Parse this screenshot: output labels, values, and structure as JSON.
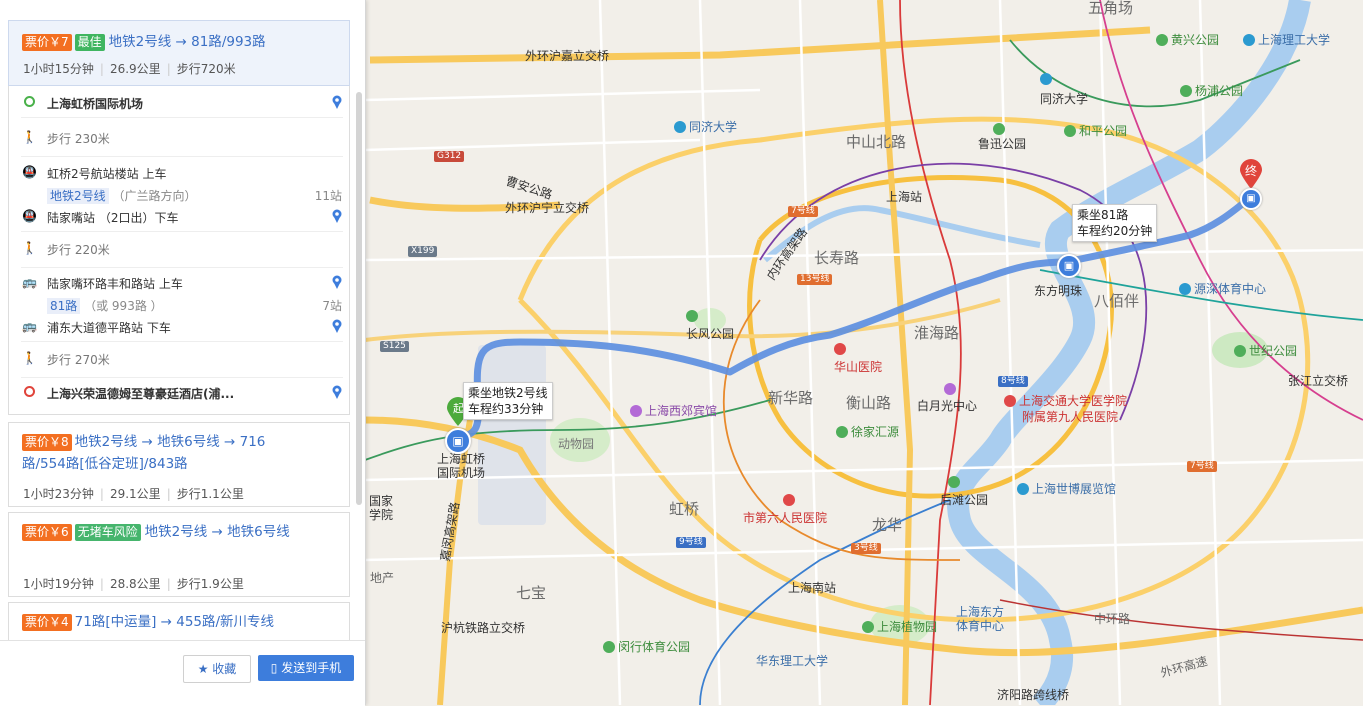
{
  "routes": [
    {
      "fare": "票价￥7",
      "tag": "最佳",
      "title": "地铁2号线 → 81路/993路",
      "duration": "1小时15分钟",
      "distance": "26.9公里",
      "walk": "步行720米"
    },
    {
      "fare": "票价￥8",
      "tag": "",
      "title_line1": "地铁2号线 → 地铁6号线 → 716",
      "title_line2": "路/554路[低谷定班]/843路",
      "duration": "1小时23分钟",
      "distance": "29.1公里",
      "walk": "步行1.1公里"
    },
    {
      "fare": "票价￥6",
      "tag": "无堵车风险",
      "title": "地铁2号线 → 地铁6号线",
      "duration": "1小时19分钟",
      "distance": "28.8公里",
      "walk": "步行1.9公里"
    },
    {
      "fare": "票价￥4",
      "tag": "",
      "title": "71路[中运量] → 455路/新川专线"
    }
  ],
  "steps": {
    "origin": "上海虹桥国际机场",
    "walk1": "步行  230米",
    "board1": "虹桥2号航站楼站  上车",
    "line1": "地铁2号线",
    "line1_dir": "（广兰路方向）",
    "line1_stops": "11站",
    "alight1": "陆家嘴站  （2口出）下车",
    "walk2": "步行  220米",
    "board2": "陆家嘴环路丰和路站  上车",
    "line2": "81路",
    "line2_alt": "（或 993路 ）",
    "line2_stops": "7站",
    "alight2": "浦东大道德平路站  下车",
    "walk3": "步行  270米",
    "destination": "上海兴荣温德姆至尊豪廷酒店(浦..."
  },
  "buttons": {
    "favorite": "收藏",
    "send": "发送到手机"
  },
  "map": {
    "tooltip1": "乘坐地铁2号线\n车程约33分钟",
    "tooltip2": "乘坐81路\n车程约20分钟",
    "start_marker": "起",
    "end_marker": "终",
    "labels": {
      "wujiaochang": "五角场",
      "huangxing": "黄兴公园",
      "usst": "上海理工大学",
      "waihuan_jiading": "外环沪嘉立交桥",
      "yangpu": "杨浦公园",
      "tongji1": "同济大学",
      "tongji2": "同济大学",
      "heping": "和平公园",
      "luxun": "鲁迅公园",
      "zhongshanbei": "中山北路",
      "shanghaizhan": "上海站",
      "caoan": "曹安公路",
      "waihuan_huning": "外环沪宁立交桥",
      "changshou": "长寿路",
      "dongfang": "东方明珠",
      "bapaiban": "八佰伴",
      "yuanshen": "源深体育中心",
      "changfeng": "长风公园",
      "huaihai": "淮海路",
      "huashan": "华山医院",
      "century": "世纪公园",
      "zhangjiang": "张江立交桥",
      "xinhua": "新华路",
      "hengshan": "衡山路",
      "xijiao": "上海西郊宾馆",
      "baiyuguang": "白月光中心",
      "jiaoda": "上海交通大学医学院",
      "jiuyuan": "附属第九人民医院",
      "xujiahui": "徐家汇源",
      "dongwuyuan": "动物园",
      "houtan": "后滩公园",
      "expo": "上海世博展览馆",
      "hongqiao_airport": "上海虹桥\n国际机场",
      "guojia": "国家\n学院",
      "hongqiao": "虹桥",
      "sixth": "市第六人民医院",
      "longhua": "龙华",
      "shanghai_south": "上海南站",
      "diqu": "地产",
      "qibao": "七宝",
      "huhang": "沪杭铁路立交桥",
      "minhang": "闵行体育公园",
      "ecust": "华东理工大学",
      "botanical": "上海植物园",
      "oriental_sports": "上海东方\n体育中心",
      "jiyang": "济阳路跨线桥",
      "zhonghuan": "中环路",
      "waihuan_gaosu": "外环高速",
      "jiamin": "嘉闵高架路",
      "neihuan": "内环高架路",
      "g312": "G312",
      "x199": "X199",
      "s125": "S125",
      "l7": "7号线",
      "l13": "13号线",
      "l8": "8号线",
      "l7b": "7号线",
      "l9": "9号线",
      "l3": "3号线"
    }
  }
}
